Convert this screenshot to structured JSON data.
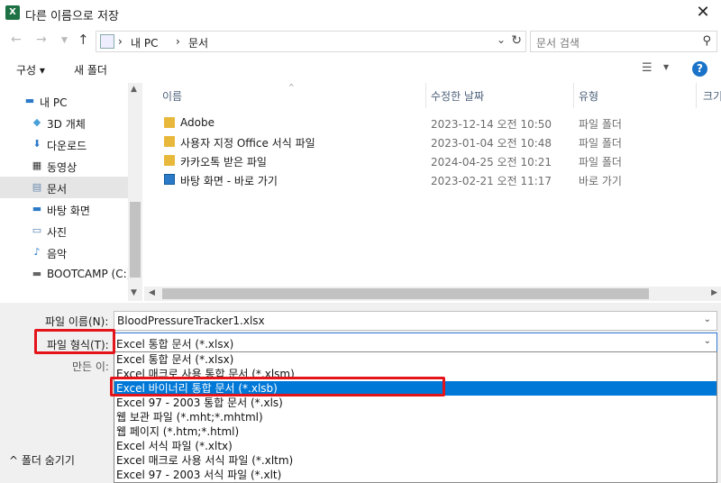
{
  "window": {
    "title": "다른 이름으로 저장",
    "app_icon": "X"
  },
  "nav": {
    "path": [
      "내 PC",
      "문서"
    ],
    "search_placeholder": "문서 검색"
  },
  "toolbar": {
    "organize": "구성 ▾",
    "new_folder": "새 폴더",
    "help": "?"
  },
  "sidebar": {
    "items": [
      {
        "label": "내 PC",
        "icon": "pc-icon"
      },
      {
        "label": "3D 개체",
        "icon": "3d-objects-icon"
      },
      {
        "label": "다운로드",
        "icon": "download-icon"
      },
      {
        "label": "동영상",
        "icon": "video-icon"
      },
      {
        "label": "문서",
        "icon": "documents-icon"
      },
      {
        "label": "바탕 화면",
        "icon": "desktop-icon"
      },
      {
        "label": "사진",
        "icon": "pictures-icon"
      },
      {
        "label": "음악",
        "icon": "music-icon"
      },
      {
        "label": "BOOTCAMP (C:)",
        "icon": "drive-icon"
      }
    ],
    "selected_index": 4
  },
  "files": {
    "columns": [
      "이름",
      "수정한 날짜",
      "유형",
      "크기"
    ],
    "rows": [
      {
        "name": "Adobe",
        "date": "2023-12-14 오전 10:50",
        "type": "파일 폴더",
        "icon": "folder-icon"
      },
      {
        "name": "사용자 지정 Office 서식 파일",
        "date": "2023-01-04 오전 10:48",
        "type": "파일 폴더",
        "icon": "folder-icon"
      },
      {
        "name": "카카오톡 받은 파일",
        "date": "2024-04-25 오전 10:21",
        "type": "파일 폴더",
        "icon": "folder-icon"
      },
      {
        "name": "바탕 화면 - 바로 가기",
        "date": "2023-02-21 오전 11:17",
        "type": "바로 가기",
        "icon": "shortcut-icon"
      }
    ]
  },
  "form": {
    "filename_label": "파일 이름(N):",
    "filename_value": "BloodPressureTracker1.xlsx",
    "filetype_label": "파일 형식(T):",
    "filetype_value": "Excel 통합 문서 (*.xlsx)",
    "author_label": "만든 이:",
    "hide_folders": "^ 폴더 숨기기"
  },
  "filetype_options": [
    "Excel 통합 문서 (*.xlsx)",
    "Excel 매크로 사용 통합 문서 (*.xlsm)",
    "Excel 바이너리 통합 문서 (*.xlsb)",
    "Excel 97 - 2003 통합 문서 (*.xls)",
    "웹 보관 파일 (*.mht;*.mhtml)",
    "웹 페이지 (*.htm;*.html)",
    "Excel 서식 파일 (*.xltx)",
    "Excel 매크로 사용 서식 파일 (*.xltm)",
    "Excel 97 - 2003 서식 파일 (*.xlt)"
  ],
  "highlighted_option_index": 2,
  "colors": {
    "highlight_box": "#e3141a",
    "selection": "#0078d7",
    "excel_green": "#1e7145"
  }
}
